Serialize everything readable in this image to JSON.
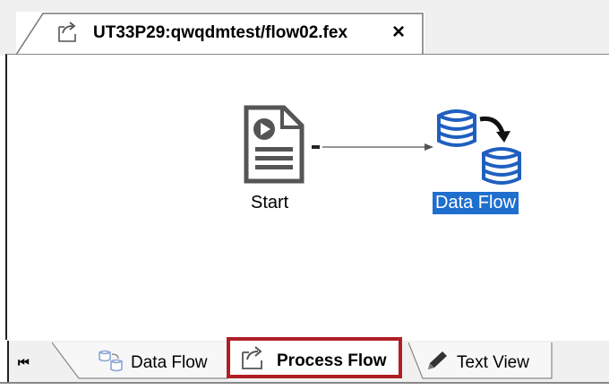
{
  "editor_tab": {
    "title": "UT33P29:qwqdmtest/flow02.fex",
    "close_label": "×",
    "icon": "process-flow-icon"
  },
  "canvas": {
    "start_node": {
      "label": "Start",
      "icon": "document-start-icon"
    },
    "dataflow_node": {
      "label": "Data Flow",
      "icon": "database-flow-icon",
      "selected": true
    }
  },
  "bottom_tabs": {
    "first_button": "⏮",
    "items": [
      {
        "label": "Data Flow",
        "icon": "data-flow-icon"
      },
      {
        "label": "Process Flow",
        "icon": "process-flow-icon",
        "active": true
      },
      {
        "label": "Text View",
        "icon": "pencil-icon"
      }
    ]
  },
  "colors": {
    "selection": "#1e6fce",
    "highlight_border": "#b01e25",
    "db_blue": "#1f5fbf"
  }
}
